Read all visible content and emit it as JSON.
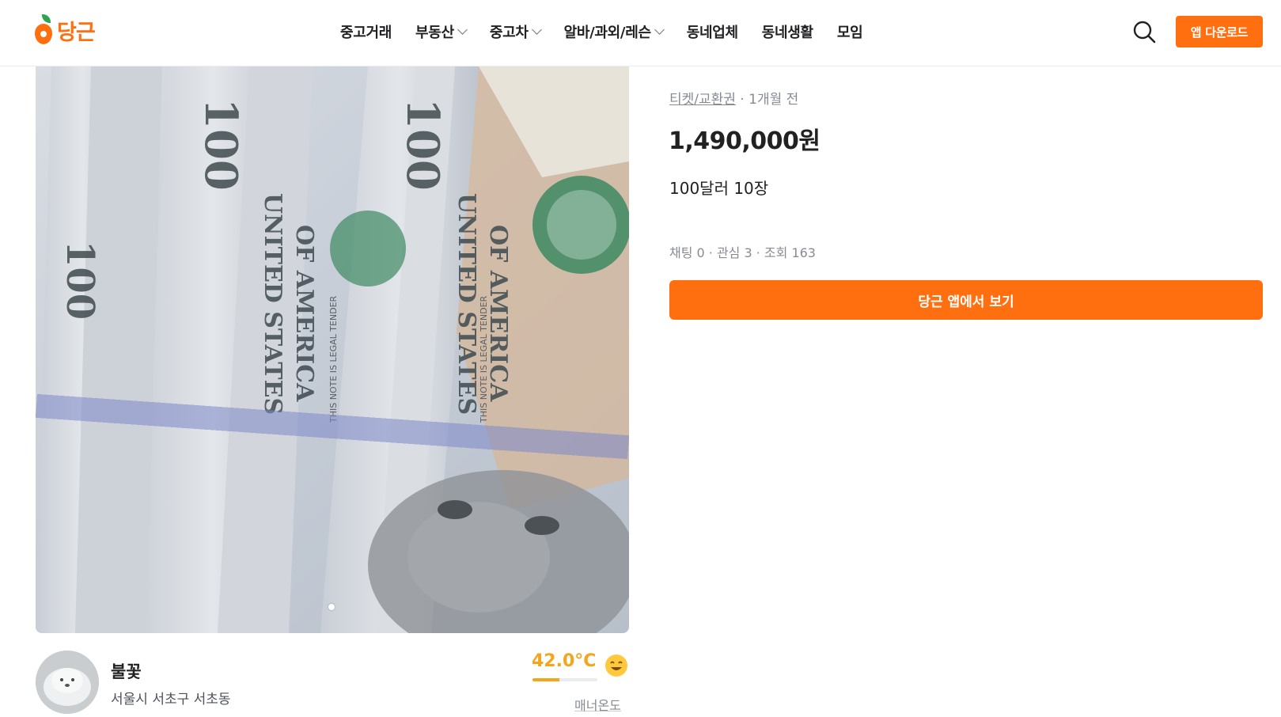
{
  "header": {
    "logo_text": "당근",
    "nav": [
      {
        "label": "중고거래",
        "has_dropdown": false
      },
      {
        "label": "부동산",
        "has_dropdown": true
      },
      {
        "label": "중고차",
        "has_dropdown": true
      },
      {
        "label": "알바/과외/레슨",
        "has_dropdown": true
      },
      {
        "label": "동네업체",
        "has_dropdown": false
      },
      {
        "label": "동네생활",
        "has_dropdown": false
      },
      {
        "label": "모임",
        "has_dropdown": false
      }
    ],
    "search_icon": "search-icon",
    "download_label": "앱 다운로드"
  },
  "product": {
    "category": "티켓/교환권",
    "time_ago": "· 1개월 전",
    "price": "1,490,000원",
    "description": "100달러 10장",
    "stats": "채팅 0 · 관심 3 · 조회 163",
    "cta_label": "당근 앱에서 보기",
    "image_dots": 1
  },
  "seller": {
    "name": "불꽃",
    "location": "서울시 서초구 서초동",
    "temperature": "42.0°C",
    "temperature_fraction": 0.42,
    "manner_label": "매너온도"
  },
  "colors": {
    "brand": "#ff6f0f",
    "temperature": "#f4a51c",
    "text": "#212124",
    "muted": "#868b94"
  }
}
